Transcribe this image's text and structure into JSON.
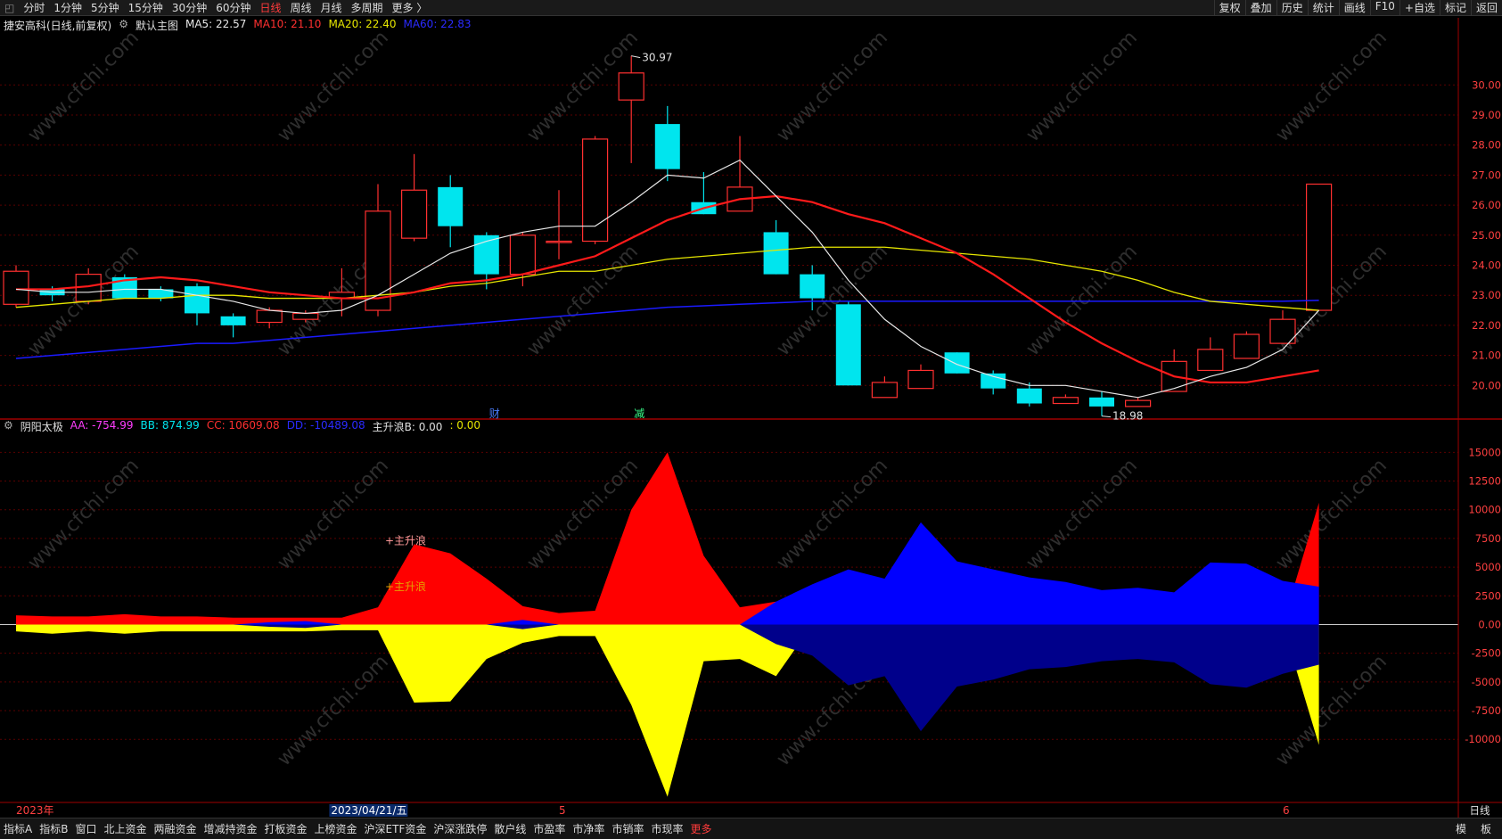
{
  "topbar": {
    "left": [
      "分时",
      "1分钟",
      "5分钟",
      "15分钟",
      "30分钟",
      "60分钟",
      "日线",
      "周线",
      "月线",
      "多周期",
      "更多 〉"
    ],
    "active": "日线",
    "right": [
      "复权",
      "叠加",
      "历史",
      "统计",
      "画线",
      "F10",
      "+自选",
      "标记",
      "返回"
    ]
  },
  "infobar1": {
    "stock": "捷安高科(日线,前复权)",
    "chart_name": "默认主图",
    "ma5": "MA5: 22.57",
    "ma10": "MA10: 21.10",
    "ma20": "MA20: 22.40",
    "ma60": "MA60: 22.83"
  },
  "infobar2": {
    "name": "阴阳太极",
    "aa": "AA: -754.99",
    "bb": "BB: 874.99",
    "cc": "CC: 10609.08",
    "dd": "DD: -10489.08",
    "zhu": "主升浪B: 0.00",
    "last": ": 0.00"
  },
  "bottombar": {
    "items": [
      "指标A",
      "指标B",
      "窗口",
      "北上资金",
      "两融资金",
      "增减持资金",
      "打板资金",
      "上榜资金",
      "沪深ETF资金",
      "沪深涨跌停",
      "散户线",
      "市盈率",
      "市净率",
      "市销率",
      "市现率",
      "更多"
    ],
    "right": [
      "模",
      "板"
    ]
  },
  "axis": {
    "top_date": "2023年",
    "cursor_date": "2023/04/21/五",
    "mid_date": "5",
    "end_date": "6",
    "period": "日线"
  },
  "markers": {
    "cai": "财",
    "jian": "减",
    "high": "30.97",
    "low": "18.98",
    "ann1": "主升浪",
    "ann2": "主升浪"
  },
  "watermark": "www.cfchi.com",
  "colors": {
    "up": "#ff3030",
    "down": "#00e5ee",
    "ma5": "#e8e8e8",
    "ma10": "#ff1a1a",
    "ma20": "#e6e600",
    "ma60": "#1a1aff",
    "cc": "#ff0000",
    "dd": "#ffff00",
    "blue": "#0000ff",
    "darkblue": "#00008b"
  },
  "chart_data": [
    {
      "type": "candlestick",
      "title": "捷安高科(日线,前复权)",
      "yticks": [
        20.0,
        21.0,
        22.0,
        23.0,
        24.0,
        25.0,
        26.0,
        27.0,
        28.0,
        29.0,
        30.0
      ],
      "ylim": [
        19.0,
        31.7
      ],
      "candles": [
        {
          "o": 22.7,
          "c": 23.8,
          "h": 24.0,
          "l": 22.6
        },
        {
          "o": 23.2,
          "c": 23.0,
          "h": 23.3,
          "l": 22.8
        },
        {
          "o": 22.8,
          "c": 23.7,
          "h": 23.9,
          "l": 22.7
        },
        {
          "o": 23.6,
          "c": 22.9,
          "h": 23.7,
          "l": 22.9
        },
        {
          "o": 23.2,
          "c": 22.9,
          "h": 23.3,
          "l": 22.8
        },
        {
          "o": 23.3,
          "c": 22.4,
          "h": 23.4,
          "l": 22.0
        },
        {
          "o": 22.3,
          "c": 22.0,
          "h": 22.4,
          "l": 21.6
        },
        {
          "o": 22.1,
          "c": 22.5,
          "h": 22.6,
          "l": 21.9
        },
        {
          "o": 22.2,
          "c": 22.4,
          "h": 22.5,
          "l": 22.1
        },
        {
          "o": 22.9,
          "c": 23.1,
          "h": 23.9,
          "l": 22.3
        },
        {
          "o": 22.5,
          "c": 25.8,
          "h": 26.7,
          "l": 22.3
        },
        {
          "o": 24.9,
          "c": 26.5,
          "h": 27.7,
          "l": 24.8
        },
        {
          "o": 26.6,
          "c": 25.3,
          "h": 27.0,
          "l": 24.6
        },
        {
          "o": 25.0,
          "c": 23.7,
          "h": 25.1,
          "l": 23.2
        },
        {
          "o": 23.7,
          "c": 25.0,
          "h": 25.1,
          "l": 23.3
        },
        {
          "o": 24.8,
          "c": 24.8,
          "h": 26.5,
          "l": 24.2
        },
        {
          "o": 24.8,
          "c": 28.2,
          "h": 28.3,
          "l": 24.7
        },
        {
          "o": 29.5,
          "c": 30.4,
          "h": 30.97,
          "l": 27.4
        },
        {
          "o": 28.7,
          "c": 27.2,
          "h": 29.3,
          "l": 26.8
        },
        {
          "o": 26.1,
          "c": 25.7,
          "h": 27.1,
          "l": 25.7
        },
        {
          "o": 25.8,
          "c": 26.6,
          "h": 28.3,
          "l": 25.8
        },
        {
          "o": 25.1,
          "c": 23.7,
          "h": 25.5,
          "l": 23.7
        },
        {
          "o": 23.7,
          "c": 22.9,
          "h": 24.0,
          "l": 22.5
        },
        {
          "o": 22.7,
          "c": 20.0,
          "h": 22.8,
          "l": 20.0
        },
        {
          "o": 19.6,
          "c": 20.1,
          "h": 20.3,
          "l": 19.6
        },
        {
          "o": 19.9,
          "c": 20.5,
          "h": 20.7,
          "l": 19.9
        },
        {
          "o": 21.1,
          "c": 20.4,
          "h": 21.1,
          "l": 20.4
        },
        {
          "o": 20.4,
          "c": 19.9,
          "h": 20.5,
          "l": 19.7
        },
        {
          "o": 19.9,
          "c": 19.4,
          "h": 20.1,
          "l": 19.3
        },
        {
          "o": 19.4,
          "c": 19.6,
          "h": 19.7,
          "l": 19.4
        },
        {
          "o": 19.6,
          "c": 19.3,
          "h": 19.8,
          "l": 18.98
        },
        {
          "o": 19.3,
          "c": 19.5,
          "h": 19.6,
          "l": 19.3
        },
        {
          "o": 19.8,
          "c": 20.8,
          "h": 21.2,
          "l": 19.8
        },
        {
          "o": 20.5,
          "c": 21.2,
          "h": 21.6,
          "l": 20.5
        },
        {
          "o": 20.9,
          "c": 21.7,
          "h": 21.8,
          "l": 20.9
        },
        {
          "o": 21.4,
          "c": 22.2,
          "h": 22.5,
          "l": 21.4
        },
        {
          "o": 22.5,
          "c": 26.7,
          "h": 26.7,
          "l": 22.5
        }
      ],
      "ma5": [
        23.2,
        23.1,
        23.1,
        23.2,
        23.2,
        23.0,
        22.8,
        22.5,
        22.4,
        22.5,
        23.0,
        23.7,
        24.4,
        24.8,
        25.1,
        25.3,
        25.3,
        26.1,
        27.0,
        26.9,
        27.5,
        26.3,
        25.1,
        23.5,
        22.2,
        21.3,
        20.7,
        20.3,
        20.0,
        20.0,
        19.8,
        19.6,
        19.9,
        20.3,
        20.6,
        21.2,
        22.5
      ],
      "ma10": [
        23.2,
        23.2,
        23.3,
        23.5,
        23.6,
        23.5,
        23.3,
        23.1,
        23.0,
        22.9,
        22.9,
        23.1,
        23.4,
        23.5,
        23.7,
        24.0,
        24.3,
        24.9,
        25.5,
        25.9,
        26.2,
        26.3,
        26.1,
        25.7,
        25.4,
        24.9,
        24.4,
        23.7,
        22.9,
        22.1,
        21.4,
        20.8,
        20.3,
        20.1,
        20.1,
        20.3,
        20.5
      ],
      "ma20": [
        22.6,
        22.7,
        22.8,
        22.9,
        22.9,
        23.0,
        23.0,
        22.9,
        22.9,
        22.9,
        23.0,
        23.1,
        23.3,
        23.4,
        23.6,
        23.8,
        23.8,
        24.0,
        24.2,
        24.3,
        24.4,
        24.5,
        24.6,
        24.6,
        24.6,
        24.5,
        24.4,
        24.3,
        24.2,
        24.0,
        23.8,
        23.5,
        23.1,
        22.8,
        22.7,
        22.6,
        22.5
      ],
      "ma60": [
        20.9,
        21.0,
        21.1,
        21.2,
        21.3,
        21.4,
        21.4,
        21.5,
        21.6,
        21.7,
        21.8,
        21.9,
        22.0,
        22.1,
        22.2,
        22.3,
        22.4,
        22.5,
        22.6,
        22.65,
        22.7,
        22.75,
        22.8,
        22.8,
        22.8,
        22.8,
        22.8,
        22.8,
        22.8,
        22.8,
        22.8,
        22.8,
        22.8,
        22.8,
        22.8,
        22.8,
        22.83
      ]
    },
    {
      "type": "area",
      "title": "阴阳太极",
      "yticks": [
        -10000,
        -7500,
        -5000,
        -2500,
        0.0,
        2500,
        5000,
        7500,
        10000,
        12500,
        15000
      ],
      "ylim": [
        -15500,
        16500
      ],
      "cc": [
        800,
        700,
        700,
        900,
        700,
        700,
        600,
        600,
        600,
        600,
        1500,
        7000,
        6200,
        4000,
        1600,
        1000,
        1200,
        10000,
        15000,
        6000,
        1500,
        2000,
        0,
        0,
        0,
        0,
        0,
        0,
        0,
        0,
        0,
        0,
        0,
        0,
        0,
        0,
        10609.08
      ],
      "dd": [
        -600,
        -800,
        -600,
        -800,
        -600,
        -600,
        -600,
        -600,
        -600,
        -500,
        -500,
        -6800,
        -6700,
        -3000,
        -1600,
        -1000,
        -1000,
        -7000,
        -15000,
        -3200,
        -3000,
        -4500,
        0,
        0,
        0,
        0,
        0,
        0,
        0,
        0,
        0,
        0,
        0,
        0,
        0,
        0,
        -10489.08
      ],
      "blue_up": [
        0,
        0,
        0,
        0,
        0,
        0,
        0,
        200,
        300,
        0,
        0,
        0,
        0,
        0,
        400,
        0,
        0,
        0,
        0,
        0,
        0,
        2000,
        3500,
        4800,
        4000,
        8900,
        5500,
        4800,
        4100,
        3700,
        3000,
        3200,
        2800,
        5400,
        5300,
        3800,
        3300
      ],
      "blue_dn": [
        0,
        0,
        0,
        0,
        0,
        0,
        0,
        -200,
        -300,
        0,
        0,
        0,
        0,
        0,
        -400,
        0,
        0,
        0,
        0,
        0,
        0,
        -1700,
        -2700,
        -5300,
        -4500,
        -9300,
        -5400,
        -4800,
        -3900,
        -3700,
        -3200,
        -3000,
        -3300,
        -5200,
        -5500,
        -4300,
        -3500
      ]
    }
  ]
}
